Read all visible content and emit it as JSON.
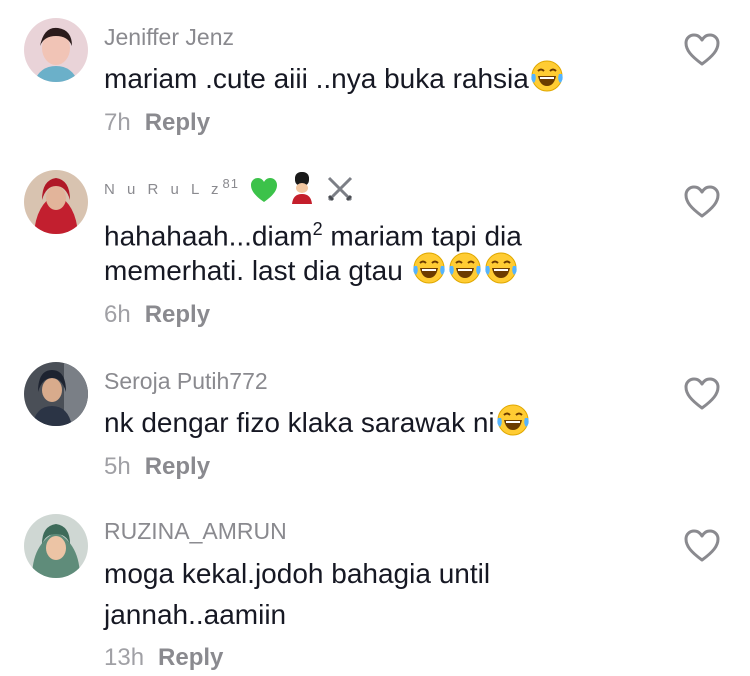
{
  "comments": [
    {
      "username": "Jeniffer Jenz",
      "lines": [
        "mariam .cute aiii ..nya buka rahsia"
      ],
      "time": "7h",
      "reply": "Reply"
    },
    {
      "username": "N u R u L z",
      "username_sup": "81",
      "line1_a": "hahahaah...diam",
      "line1_sup": "2",
      "line1_b": " mariam tapi dia",
      "line2": "memerhati. last dia gtau ",
      "time": "6h",
      "reply": "Reply"
    },
    {
      "username": "Seroja Putih772",
      "lines": [
        "nk dengar fizo klaka sarawak ni"
      ],
      "time": "5h",
      "reply": "Reply"
    },
    {
      "username": "RUZINA_AMRUN",
      "lines": [
        "moga kekal.jodoh bahagia until",
        "jannah..aamiin"
      ],
      "time": "13h",
      "reply": "Reply"
    }
  ],
  "icons": {
    "like": "heart-outline-icon",
    "emoji_laugh": "face-with-tears-of-joy-emoji",
    "green_heart": "green-heart-emoji",
    "guard": "guardsman-emoji",
    "swords": "crossed-swords-emoji"
  },
  "colors": {
    "text": "#161823",
    "username": "#8a8a8f",
    "meta": "#a0a0a5",
    "emoji_face": "#ffcc33"
  }
}
